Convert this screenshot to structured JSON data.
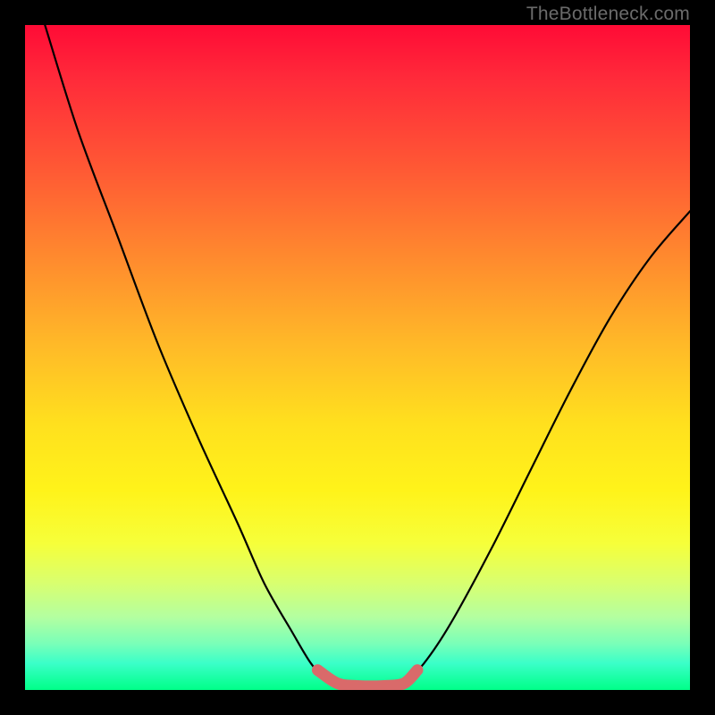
{
  "watermark": {
    "text": "TheBottleneck.com"
  },
  "colors": {
    "curve_stroke": "#000000",
    "highlight_stroke": "#d96a6a",
    "frame_bg": "#000000"
  },
  "chart_data": {
    "type": "line",
    "title": "",
    "xlabel": "",
    "ylabel": "",
    "xlim": [
      0,
      100
    ],
    "ylim": [
      0,
      100
    ],
    "series": [
      {
        "name": "left-curve",
        "x": [
          3,
          8,
          14,
          20,
          26,
          32,
          36,
          40,
          43,
          45,
          47
        ],
        "y": [
          100,
          84,
          68,
          52,
          38,
          25,
          16,
          9,
          4,
          2,
          1
        ]
      },
      {
        "name": "valley-floor",
        "x": [
          47,
          49,
          51,
          53,
          55,
          57
        ],
        "y": [
          1,
          0.5,
          0.5,
          0.5,
          0.5,
          1
        ]
      },
      {
        "name": "right-curve",
        "x": [
          57,
          60,
          64,
          70,
          76,
          82,
          88,
          94,
          100
        ],
        "y": [
          1,
          4,
          10,
          21,
          33,
          45,
          56,
          65,
          72
        ]
      },
      {
        "name": "highlight-segment",
        "x": [
          44,
          47,
          50,
          54,
          57,
          59
        ],
        "y": [
          3,
          1,
          0.6,
          0.6,
          1,
          3
        ]
      }
    ],
    "annotations": []
  }
}
